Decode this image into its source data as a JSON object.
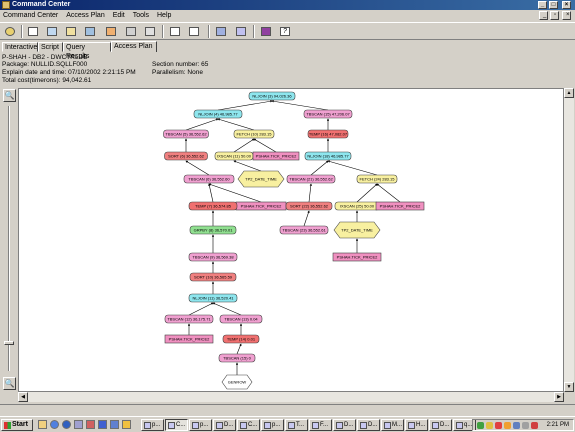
{
  "window": {
    "title": "Command Center"
  },
  "menu": [
    "Command Center",
    "Access Plan",
    "Edit",
    "Tools",
    "Help"
  ],
  "tabs": [
    {
      "label": "Interactive",
      "active": false
    },
    {
      "label": "Script",
      "active": false
    },
    {
      "label": "Query Results",
      "active": false
    },
    {
      "label": "Access Plan",
      "active": true
    }
  ],
  "plan_info": {
    "db": "P-SHAH - DB2 - DWCTRLDB",
    "package": "Package: NULLID.SQLLF000",
    "section": "Section number: 65",
    "explain_time": "Explain date and time: 07/10/2002 2:21:15 PM",
    "parallelism": "Parallelism: None",
    "total_cost": "Total cost(timerons): 94,042.61"
  },
  "colors": {
    "nljoin": "#8ee6ee",
    "tbscan": "#f0a0d0",
    "fetch": "#f8f0a0",
    "sort": "#f08080",
    "temp": "#f07070",
    "table": "#f090c0",
    "grpby": "#90e090",
    "ixscan": "#f8f0a0",
    "index": "#f8f0a0"
  },
  "graph": {
    "nodes": [
      {
        "id": "n1",
        "label": "NLJOIN (3) 94,026.36",
        "type": "nljoin"
      },
      {
        "id": "n2",
        "label": "NLJOIN (4) 46,985.77",
        "type": "nljoin"
      },
      {
        "id": "n3",
        "label": "TBSCAN (15) 47,206.07",
        "type": "tbscan"
      },
      {
        "id": "n4",
        "label": "TBSCAN (5) 36,552.62",
        "type": "tbscan"
      },
      {
        "id": "n5",
        "label": "FETCH (10) 283.15",
        "type": "fetch"
      },
      {
        "id": "n6",
        "label": "TEMP (16) 47,082.07",
        "type": "temp"
      },
      {
        "id": "n7",
        "label": "SORT (6) 36,552.62",
        "type": "sort"
      },
      {
        "id": "n8",
        "label": "IXSCAN (11) 50.00",
        "type": "ixscan"
      },
      {
        "id": "n9",
        "label": "PSHAH.TICK_PRICE2",
        "type": "table"
      },
      {
        "id": "n10",
        "label": "NLJOIN (18) 46,985.77",
        "type": "nljoin"
      },
      {
        "id": "n11",
        "label": "TBSCAN (6) 36,552.60",
        "type": "tbscan"
      },
      {
        "id": "n12",
        "label": "TP2_DATE_TIME",
        "type": "index"
      },
      {
        "id": "n13",
        "label": "TBSCAN (21) 36,552.62",
        "type": "tbscan"
      },
      {
        "id": "n14",
        "label": "FETCH (24) 283.15",
        "type": "fetch"
      },
      {
        "id": "n15",
        "label": "PSHAH.TICK_PRICE2",
        "type": "table"
      },
      {
        "id": "n16",
        "label": "TEMP (7) 36,574.85",
        "type": "temp"
      },
      {
        "id": "n17",
        "label": "SORT (22) 36,552.62",
        "type": "sort"
      },
      {
        "id": "n18",
        "label": "IXSCAN (25) 50.00",
        "type": "ixscan"
      },
      {
        "id": "n19",
        "label": "PSHAH.TICK_PRICE2",
        "type": "table"
      },
      {
        "id": "n20",
        "label": "GRPBY (8) 36,570.01",
        "type": "grpby"
      },
      {
        "id": "n21",
        "label": "TBSCAN (23) 36,552.61",
        "type": "tbscan"
      },
      {
        "id": "n22",
        "label": "TP2_DATE_TIME",
        "type": "index"
      },
      {
        "id": "n23",
        "label": "TBSCAN (9) 36,569.38",
        "type": "tbscan"
      },
      {
        "id": "n24",
        "label": "PSHAH.TICK_PRICE2",
        "type": "table"
      },
      {
        "id": "n25",
        "label": "SORT (10) 36,565.59",
        "type": "sort"
      },
      {
        "id": "n26",
        "label": "NLJOIN (11) 36,520.41",
        "type": "nljoin"
      },
      {
        "id": "n27",
        "label": "TBSCAN (12) 36,175.71",
        "type": "tbscan"
      },
      {
        "id": "n28",
        "label": "TBSCAN (13) 0.04",
        "type": "tbscan"
      },
      {
        "id": "n29",
        "label": "PSHAH.TICK_PRICE2",
        "type": "table"
      },
      {
        "id": "n30",
        "label": "TEMP (14) 0.01",
        "type": "temp"
      },
      {
        "id": "n31",
        "label": "TBSCAN (15) 0",
        "type": "tbscan"
      },
      {
        "id": "n32",
        "label": "GENROW",
        "type": "genrow"
      }
    ]
  },
  "taskbar": {
    "start_label": "Start",
    "tasks": [
      "p...",
      "C...",
      "p...",
      "D...",
      "C...",
      "p...",
      "T...",
      "F...",
      "D...",
      "D...",
      "M...",
      "H...",
      "D...",
      "q..."
    ],
    "clock": "2:21 PM"
  }
}
